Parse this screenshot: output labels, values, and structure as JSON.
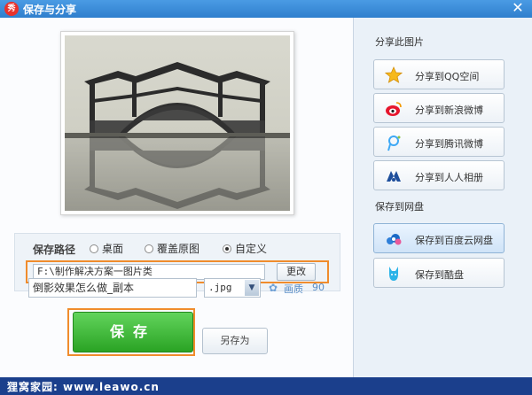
{
  "window": {
    "app_icon_text": "秀",
    "title": "保存与分享",
    "close_glyph": "✕"
  },
  "save": {
    "path_label": "保存路径",
    "options": [
      {
        "label": "桌面",
        "selected": false
      },
      {
        "label": "覆盖原图",
        "selected": false
      },
      {
        "label": "自定义",
        "selected": true
      }
    ],
    "path_value": "F:\\制作解决方案一图片类",
    "change_label": "更改",
    "filename": "倒影效果怎么做_副本",
    "extension": ".jpg",
    "quality_label": "画质",
    "quality_value": "90",
    "save_label": "保存",
    "save_as_label": "另存为"
  },
  "share": {
    "section_title": "分享此图片",
    "buttons": [
      {
        "label": "分享到QQ空间",
        "icon": "qzone-star-icon"
      },
      {
        "label": "分享到新浪微博",
        "icon": "sina-weibo-icon"
      },
      {
        "label": "分享到腾讯微博",
        "icon": "tencent-weibo-icon"
      },
      {
        "label": "分享到人人相册",
        "icon": "renren-icon"
      }
    ]
  },
  "cloud": {
    "section_title": "保存到网盘",
    "buttons": [
      {
        "label": "保存到百度云网盘",
        "icon": "baidu-cloud-icon"
      },
      {
        "label": "保存到酷盘",
        "icon": "kupan-icon"
      }
    ]
  },
  "footer": {
    "watermark": "狸窝家园: www.leawo.cn"
  },
  "colors": {
    "title_bar": "#3a8bd8",
    "highlight_orange": "#f08c2c",
    "save_green": "#3cb534",
    "footer_blue": "#1b3f8c"
  }
}
